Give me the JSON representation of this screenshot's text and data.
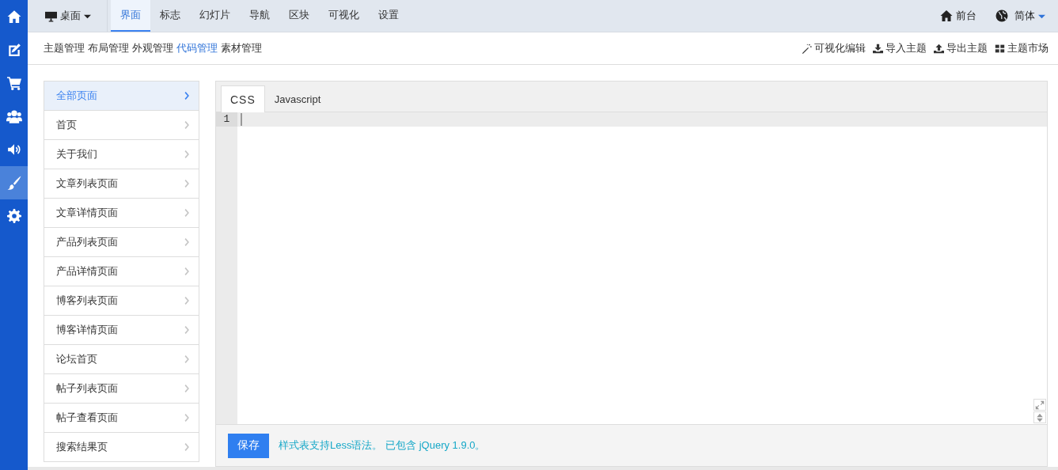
{
  "rail": [
    {
      "selected": false
    },
    {
      "selected": false
    },
    {
      "selected": false
    },
    {
      "selected": false
    },
    {
      "selected": false
    },
    {
      "selected": true
    },
    {
      "selected": false
    }
  ],
  "device_menu": {
    "label": "桌面"
  },
  "tabs": [
    {
      "label": "界面",
      "selected": true
    },
    {
      "label": "标志",
      "selected": false
    },
    {
      "label": "幻灯片",
      "selected": false
    },
    {
      "label": "导航",
      "selected": false
    },
    {
      "label": "区块",
      "selected": false
    },
    {
      "label": "可视化",
      "selected": false
    },
    {
      "label": "设置",
      "selected": false
    }
  ],
  "top_right": {
    "frontend": "前台",
    "language": "简体"
  },
  "subnav": [
    {
      "label": "主题管理",
      "selected": false
    },
    {
      "label": "布局管理",
      "selected": false
    },
    {
      "label": "外观管理",
      "selected": false
    },
    {
      "label": "代码管理",
      "selected": true
    },
    {
      "label": "素材管理",
      "selected": false
    }
  ],
  "actions": [
    {
      "label": "可视化编辑"
    },
    {
      "label": "导入主题"
    },
    {
      "label": "导出主题"
    },
    {
      "label": "主题市场"
    }
  ],
  "pages": [
    {
      "label": "全部页面",
      "selected": true
    },
    {
      "label": "首页",
      "selected": false
    },
    {
      "label": "关于我们",
      "selected": false
    },
    {
      "label": "文章列表页面",
      "selected": false
    },
    {
      "label": "文章详情页面",
      "selected": false
    },
    {
      "label": "产品列表页面",
      "selected": false
    },
    {
      "label": "产品详情页面",
      "selected": false
    },
    {
      "label": "博客列表页面",
      "selected": false
    },
    {
      "label": "博客详情页面",
      "selected": false
    },
    {
      "label": "论坛首页",
      "selected": false
    },
    {
      "label": "帖子列表页面",
      "selected": false
    },
    {
      "label": "帖子查看页面",
      "selected": false
    },
    {
      "label": "搜索结果页",
      "selected": false
    }
  ],
  "editor": {
    "tabs": [
      {
        "label": "CSS",
        "selected": true
      },
      {
        "label": "Javascript",
        "selected": false
      }
    ],
    "line_numbers": [
      "1"
    ],
    "save_button": "保存",
    "hint": "样式表支持Less语法。 已包含 jQuery 1.9.0。"
  }
}
